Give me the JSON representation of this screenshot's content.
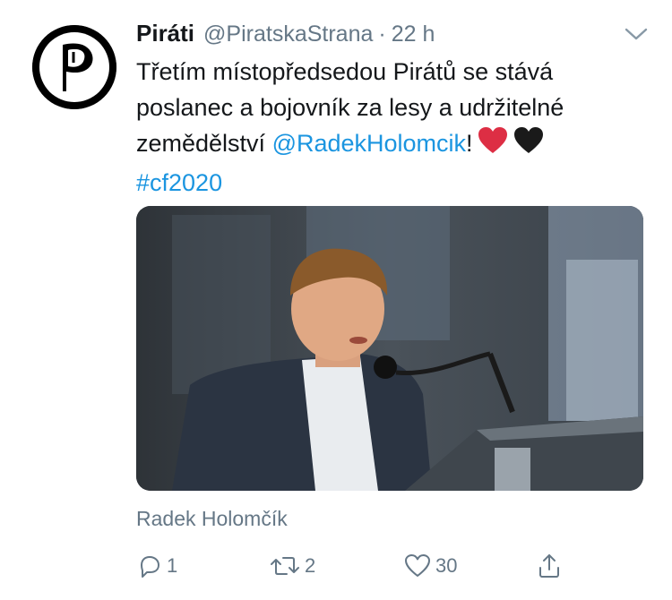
{
  "tweet": {
    "author_name": "Piráti",
    "handle": "@PiratskaStrana",
    "separator": "·",
    "time": "22 h",
    "text_line1": "Třetím místopředsedou Pirátů se stává",
    "text_line2": "poslanec a bojovník za lesy a udržitelné",
    "text_line3_prefix": "zemědělství ",
    "mention": "@RadekHolomcik",
    "text_line3_suffix": "!",
    "hashtag": "#cf2020",
    "emojis": [
      "red-heart",
      "black-heart"
    ],
    "media_caption": "Radek Holomčík"
  },
  "actions": {
    "reply_count": "1",
    "retweet_count": "2",
    "like_count": "30"
  },
  "icons": {
    "avatar": "pirate-party-flag-logo",
    "menu": "chevron-down-icon",
    "reply": "reply-icon",
    "retweet": "retweet-icon",
    "like": "heart-icon",
    "share": "share-icon"
  },
  "colors": {
    "link": "#1b95e0",
    "secondary_text": "#657786",
    "primary_text": "#14171a",
    "heart_red": "#e0245e",
    "heart_black": "#1a1a1a"
  }
}
